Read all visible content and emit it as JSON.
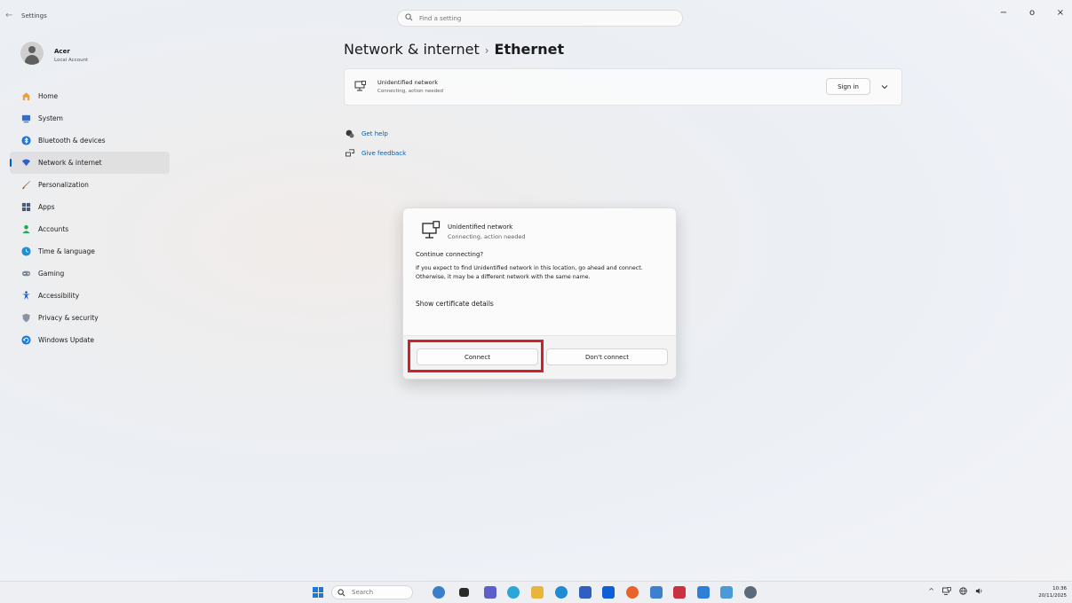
{
  "window": {
    "app_title": "Settings",
    "search_placeholder": "Find a setting",
    "controls": {
      "minimize": "−",
      "maximize": "o",
      "close": "×"
    }
  },
  "profile": {
    "name": "Acer",
    "account_type": "Local Account"
  },
  "sidebar": {
    "items": [
      {
        "label": "Home",
        "icon": "home-icon",
        "color": "#e9a23b"
      },
      {
        "label": "System",
        "icon": "system-icon",
        "color": "#2f6fd1"
      },
      {
        "label": "Bluetooth & devices",
        "icon": "bluetooth-icon",
        "color": "#1e73d8"
      },
      {
        "label": "Network & internet",
        "icon": "wifi-icon",
        "color": "#2d63c8",
        "active": true
      },
      {
        "label": "Personalization",
        "icon": "brush-icon",
        "color": "#c77b2d"
      },
      {
        "label": "Apps",
        "icon": "apps-icon",
        "color": "#4a5a78"
      },
      {
        "label": "Accounts",
        "icon": "accounts-icon",
        "color": "#27a65a"
      },
      {
        "label": "Time & language",
        "icon": "globe-clock-icon",
        "color": "#1f8fd0"
      },
      {
        "label": "Gaming",
        "icon": "gamepad-icon",
        "color": "#7d8a96"
      },
      {
        "label": "Accessibility",
        "icon": "accessibility-icon",
        "color": "#1a56b8"
      },
      {
        "label": "Privacy & security",
        "icon": "shield-icon",
        "color": "#8a93a0"
      },
      {
        "label": "Windows Update",
        "icon": "update-icon",
        "color": "#1f7ad4"
      }
    ]
  },
  "main": {
    "breadcrumb_parent": "Network & internet",
    "breadcrumb_separator": "›",
    "breadcrumb_current": "Ethernet",
    "network_card": {
      "name": "Unidentified network",
      "status": "Connecting, action needed",
      "sign_in_label": "Sign in"
    },
    "links": [
      {
        "label": "Get help",
        "icon": "help-icon"
      },
      {
        "label": "Give feedback",
        "icon": "feedback-icon"
      }
    ]
  },
  "dialog": {
    "network_name": "Unidentified network",
    "network_status": "Connecting, action needed",
    "question": "Continue connecting?",
    "body": "If you expect to find Unidentified network in this location, go ahead and connect. Otherwise, it may be a different network with the same name.",
    "cert_link": "Show certificate details",
    "connect_label": "Connect",
    "dont_connect_label": "Don't connect"
  },
  "taskbar": {
    "search_placeholder": "Search",
    "apps": [
      {
        "name": "widgets-icon",
        "color": "#3c7fc9"
      },
      {
        "name": "task-view-icon",
        "color": "#2b2b2b"
      },
      {
        "name": "teams-icon",
        "color": "#5b5fc7"
      },
      {
        "name": "copilot-icon",
        "color": "#2aa6d8"
      },
      {
        "name": "file-explorer-icon",
        "color": "#e9b43c"
      },
      {
        "name": "edge-icon",
        "color": "#1f8bd4"
      },
      {
        "name": "store-icon",
        "color": "#2f5fbf"
      },
      {
        "name": "dropbox-icon",
        "color": "#0d5fd8"
      },
      {
        "name": "firefox-icon",
        "color": "#e8632a"
      },
      {
        "name": "app-icon",
        "color": "#3f7fd0"
      },
      {
        "name": "app-red-icon",
        "color": "#c93040"
      },
      {
        "name": "app-blue-icon",
        "color": "#2f7fd8"
      },
      {
        "name": "photos-icon",
        "color": "#4a9ad8"
      },
      {
        "name": "settings-icon",
        "color": "#5a6a7a"
      }
    ],
    "tray": {
      "chevron": "^",
      "network_icon": "ethernet-icon",
      "globe_icon": "globe-icon",
      "volume_icon": "volume-icon"
    },
    "time": "10:36",
    "date": "20/11/2025"
  }
}
